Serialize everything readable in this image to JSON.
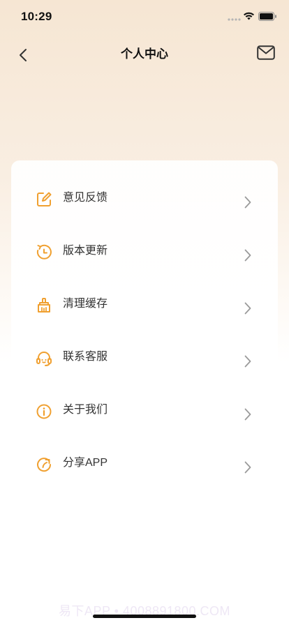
{
  "status_bar": {
    "time": "10:29"
  },
  "nav": {
    "title": "个人中心",
    "back_icon": "chevron-left-icon",
    "mail_icon": "mail-icon"
  },
  "menu": {
    "items": [
      {
        "label": "意见反馈",
        "icon": "feedback-edit-icon"
      },
      {
        "label": "版本更新",
        "icon": "update-clock-icon"
      },
      {
        "label": "清理缓存",
        "icon": "broom-icon"
      },
      {
        "label": "联系客服",
        "icon": "headset-icon"
      },
      {
        "label": "关于我们",
        "icon": "info-icon"
      },
      {
        "label": "分享APP",
        "icon": "share-refresh-icon"
      }
    ]
  },
  "watermark": "易下APP • 4008891800.COM",
  "colors": {
    "accent": "#f0a030",
    "arrow": "#9a9a9a",
    "text": "#333333"
  }
}
